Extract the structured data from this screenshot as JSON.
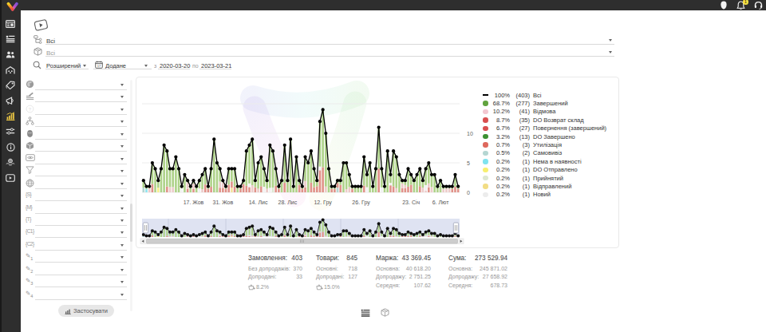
{
  "topbar": {
    "notifications_badge": "1"
  },
  "sidebar": {
    "items": [
      {
        "icon": "dashboard-icon"
      },
      {
        "icon": "orders-list-icon"
      },
      {
        "icon": "users-icon"
      },
      {
        "icon": "warehouse-icon"
      },
      {
        "icon": "pricetag-icon"
      },
      {
        "icon": "megaphone-icon"
      },
      {
        "icon": "analytics-icon",
        "active": true
      },
      {
        "icon": "sliders-icon"
      },
      {
        "icon": "info-icon"
      },
      {
        "icon": "partners-icon"
      },
      {
        "icon": "video-icon"
      }
    ]
  },
  "toolbar": {
    "status_filter": {
      "value": "Всі"
    },
    "product_filter": {
      "value": "Всі"
    },
    "search_mode": {
      "value": "Розширений"
    },
    "date_field": {
      "value": "Додане"
    },
    "date_from_label": "з",
    "date_from": "2020-03-20",
    "date_to_label": "по",
    "date_to": "2023-03-21"
  },
  "filter_panel": {
    "rows": [
      {
        "icon": "globe-solid-icon"
      },
      {
        "icon": "pen-lines-icon"
      },
      {
        "icon": "question-circle-icon"
      },
      {
        "icon": "hierarchy-icon"
      },
      {
        "icon": "person-dark-icon"
      },
      {
        "icon": "cube-icon"
      },
      {
        "icon": "banner-eye-icon"
      },
      {
        "icon": "funnel-icon"
      },
      {
        "icon": "globe-wire-icon"
      },
      {
        "icon": "braces-icon",
        "glyph": "S"
      },
      {
        "icon": "braces-icon",
        "glyph": "M"
      },
      {
        "icon": "braces-icon",
        "glyph": "T"
      },
      {
        "icon": "braces-icon",
        "glyph": "C1"
      },
      {
        "icon": "braces-icon",
        "glyph": "C2"
      },
      {
        "icon": "pencil-icon",
        "glyph": "1"
      },
      {
        "icon": "pencil-icon",
        "glyph": "2"
      },
      {
        "icon": "pencil-icon",
        "glyph": "3"
      },
      {
        "icon": "pencil-icon",
        "glyph": "4"
      }
    ],
    "apply_label": "Застосувати"
  },
  "chart_data": {
    "type": "line+stacked-bar",
    "title": "",
    "ylim": [
      0,
      15
    ],
    "y_ticks": [
      0,
      5,
      10
    ],
    "x_tick_indices": [
      17,
      27,
      39,
      49,
      61,
      74,
      91,
      101
    ],
    "x_tick_labels": [
      "17. Жов",
      "31. Жов",
      "14. Лис",
      "28. Лис",
      "12. Гру",
      "26. Гру",
      "23. Січ",
      "6. Лют"
    ],
    "totals": [
      2,
      1,
      1,
      5,
      4,
      2,
      4,
      8,
      7,
      4,
      4,
      6,
      4,
      1,
      3,
      2,
      1,
      2,
      1,
      2,
      3,
      4,
      1,
      4,
      9,
      5,
      4,
      2,
      1,
      4,
      4,
      4,
      1,
      1,
      2,
      7,
      8,
      9,
      2,
      5,
      6,
      4,
      2,
      8,
      7,
      4,
      1,
      2,
      8,
      2,
      9,
      1,
      6,
      2,
      1,
      6,
      5,
      7,
      4,
      2,
      12,
      14,
      10,
      4,
      1,
      1,
      2,
      2,
      5,
      5,
      3,
      1,
      1,
      1,
      1,
      6,
      3,
      5,
      1,
      4,
      11,
      4,
      1,
      7,
      3,
      7,
      6,
      3,
      2,
      2,
      4,
      3,
      2,
      3,
      4,
      2,
      4,
      5,
      3,
      3,
      1,
      2,
      1,
      1,
      1,
      1,
      3,
      1
    ],
    "bars": [
      [
        [
          "t",
          0.8
        ],
        [
          "g",
          1.2
        ]
      ],
      [
        [
          "c",
          0.6
        ],
        [
          "g",
          0.4
        ]
      ],
      [
        [
          "p",
          0.7
        ],
        [
          "g",
          0.3
        ]
      ],
      [
        [
          "r",
          1.41
        ],
        [
          "g",
          3.59
        ]
      ],
      [
        [
          "g",
          4.0
        ]
      ],
      [
        [
          "y",
          0.8
        ],
        [
          "g",
          1.2
        ]
      ],
      [
        [
          "g",
          4.0
        ]
      ],
      [
        [
          "g",
          8.0
        ]
      ],
      [
        [
          "r",
          0.99
        ],
        [
          "g",
          6.01
        ]
      ],
      [
        [
          "p",
          0.89
        ],
        [
          "g",
          3.11
        ]
      ],
      [
        [
          "p",
          0.89
        ],
        [
          "g",
          3.11
        ]
      ],
      [
        [
          "g",
          6.0
        ]
      ],
      [
        [
          "g",
          4.0
        ]
      ],
      [
        [
          "w",
          0.71
        ],
        [
          "g",
          0.29
        ]
      ],
      [
        [
          "g",
          3.0
        ]
      ],
      [
        [
          "r",
          0.59
        ],
        [
          "p",
          1.11
        ],
        [
          "g",
          0.3
        ]
      ],
      [
        [
          "g",
          1.0
        ]
      ],
      [
        [
          "r",
          0.61
        ],
        [
          "p",
          0.89
        ],
        [
          "g",
          0.5
        ]
      ],
      [
        [
          "g",
          1.0
        ]
      ],
      [
        [
          "w",
          0.68
        ],
        [
          "g",
          1.32
        ]
      ],
      [
        [
          "p",
          0.54
        ],
        [
          "g",
          2.46
        ]
      ],
      [
        [
          "r",
          1.33
        ],
        [
          "g",
          2.67
        ]
      ],
      [
        [
          "r",
          0.6
        ],
        [
          "g",
          0.4
        ]
      ],
      [
        [
          "r",
          0.95
        ],
        [
          "g",
          3.05
        ]
      ],
      [
        [
          "g",
          9.0
        ]
      ],
      [
        [
          "g",
          5.0
        ]
      ],
      [
        [
          "r",
          0.78
        ],
        [
          "p",
          1.04
        ],
        [
          "g",
          2.18
        ]
      ],
      [
        [
          "r",
          0.76
        ],
        [
          "p",
          0.94
        ],
        [
          "g",
          0.3
        ]
      ],
      [
        [
          "r",
          0.6
        ],
        [
          "g",
          0.4
        ]
      ],
      [
        [
          "r",
          1.31
        ],
        [
          "g",
          2.69
        ]
      ],
      [
        [
          "ly",
          0.8
        ],
        [
          "r",
          1.04
        ],
        [
          "g",
          2.16
        ]
      ],
      [
        [
          "r",
          0.97
        ],
        [
          "g",
          3.03
        ]
      ],
      [
        [
          "g",
          1.0
        ]
      ],
      [
        [
          "r",
          0.6
        ],
        [
          "g",
          0.4
        ]
      ],
      [
        [
          "r",
          1.41
        ],
        [
          "g",
          0.59
        ]
      ],
      [
        [
          "r",
          1.1
        ],
        [
          "g",
          5.9
        ]
      ],
      [
        [
          "r",
          0.89
        ],
        [
          "w",
          0.62
        ],
        [
          "g",
          6.49
        ]
      ],
      [
        [
          "p",
          1.22
        ],
        [
          "g",
          7.78
        ]
      ],
      [
        [
          "r",
          0.86
        ],
        [
          "g",
          1.14
        ]
      ],
      [
        [
          "p",
          0.62
        ],
        [
          "g",
          4.38
        ]
      ],
      [
        [
          "r",
          1.04
        ],
        [
          "g",
          4.96
        ]
      ],
      [
        [
          "w",
          0.94
        ],
        [
          "g",
          3.06
        ]
      ],
      [
        [
          "p",
          0.62
        ],
        [
          "g",
          1.38
        ]
      ],
      [
        [
          "w",
          0.77
        ],
        [
          "g",
          7.23
        ]
      ],
      [
        [
          "lg",
          0.8
        ],
        [
          "g",
          6.2
        ]
      ],
      [
        [
          "r",
          1.1
        ],
        [
          "g",
          2.9
        ]
      ],
      [
        [
          "r",
          0.6
        ],
        [
          "g",
          0.4
        ]
      ],
      [
        [
          "g",
          2.0
        ]
      ],
      [
        [
          "r",
          1.61
        ],
        [
          "g",
          6.39
        ]
      ],
      [
        [
          "g",
          2.0
        ]
      ],
      [
        [
          "g",
          9.0
        ]
      ],
      [
        [
          "g",
          1.0
        ]
      ],
      [
        [
          "g",
          6.0
        ]
      ],
      [
        [
          "r",
          1.27
        ],
        [
          "g",
          0.73
        ]
      ],
      [
        [
          "r",
          0.6
        ],
        [
          "g",
          0.4
        ]
      ],
      [
        [
          "r",
          0.84
        ],
        [
          "p",
          1.07
        ],
        [
          "g",
          4.09
        ]
      ],
      [
        [
          "g",
          5.0
        ]
      ],
      [
        [
          "r",
          1.64
        ],
        [
          "g",
          5.36
        ]
      ],
      [
        [
          "r",
          0.88
        ],
        [
          "g",
          3.12
        ]
      ],
      [
        [
          "r",
          1.04
        ],
        [
          "g",
          0.96
        ]
      ],
      [
        [
          "r",
          3.74
        ],
        [
          "w",
          0.63
        ],
        [
          "g",
          7.63
        ]
      ],
      [
        [
          "r",
          4.26
        ],
        [
          "g",
          9.74
        ]
      ],
      [
        [
          "p",
          0.99
        ],
        [
          "g",
          9.01
        ]
      ],
      [
        [
          "g",
          4.0
        ]
      ],
      [
        [
          "r",
          0.6
        ],
        [
          "g",
          0.4
        ]
      ],
      [
        [
          "r",
          0.6
        ],
        [
          "g",
          0.4
        ]
      ],
      [
        [
          "t",
          0.8
        ],
        [
          "r",
          0.8
        ],
        [
          "g",
          0.4
        ]
      ],
      [
        [
          "r",
          1.28
        ],
        [
          "g",
          0.72
        ]
      ],
      [
        [
          "g",
          5.0
        ]
      ],
      [
        [
          "p",
          0.54
        ],
        [
          "g",
          4.46
        ]
      ],
      [
        [
          "p",
          0.9
        ],
        [
          "g",
          2.1
        ]
      ],
      [
        [
          "r",
          0.6
        ],
        [
          "g",
          0.4
        ]
      ],
      [
        [
          "g",
          1.0
        ]
      ],
      [
        [
          "g",
          1.0
        ]
      ],
      [
        [
          "g",
          1.0
        ]
      ],
      [
        [
          "r",
          1.14
        ],
        [
          "g",
          4.86
        ]
      ],
      [
        [
          "w",
          0.87
        ],
        [
          "g",
          2.13
        ]
      ],
      [
        [
          "g",
          5.0
        ]
      ],
      [
        [
          "g",
          1.0
        ]
      ],
      [
        [
          "g",
          4.0
        ]
      ],
      [
        [
          "r",
          4.0
        ],
        [
          "g",
          7.0
        ]
      ],
      [
        [
          "w",
          0.84
        ],
        [
          "g",
          3.16
        ]
      ],
      [
        [
          "g",
          1.0
        ]
      ],
      [
        [
          "g",
          7.0
        ]
      ],
      [
        [
          "r",
          1.19
        ],
        [
          "w",
          0.41
        ],
        [
          "g",
          1.4
        ]
      ],
      [
        [
          "r",
          1.03
        ],
        [
          "g",
          5.97
        ]
      ],
      [
        [
          "p",
          0.71
        ],
        [
          "g",
          5.29
        ]
      ],
      [
        [
          "g",
          3.0
        ]
      ],
      [
        [
          "r",
          0.73
        ],
        [
          "p",
          0.78
        ],
        [
          "g",
          0.5
        ]
      ],
      [
        [
          "r",
          0.68
        ],
        [
          "p",
          0.56
        ],
        [
          "g",
          0.76
        ]
      ],
      [
        [
          "r",
          0.96
        ],
        [
          "g",
          3.04
        ]
      ],
      [
        [
          "r",
          1.28
        ],
        [
          "g",
          1.72
        ]
      ],
      [
        [
          "g",
          2.0
        ]
      ],
      [
        [
          "g",
          3.0
        ]
      ],
      [
        [
          "r",
          1.05
        ],
        [
          "g",
          2.95
        ]
      ],
      [
        [
          "p",
          0.79
        ],
        [
          "g",
          1.21
        ]
      ],
      [
        [
          "p",
          0.32
        ],
        [
          "w",
          0.91
        ],
        [
          "g",
          2.77
        ]
      ],
      [
        [
          "r",
          0.83
        ],
        [
          "p",
          0.69
        ],
        [
          "g",
          3.48
        ]
      ],
      [
        [
          "p",
          0.91
        ],
        [
          "g",
          2.09
        ]
      ],
      [
        [
          "g",
          3.0
        ]
      ],
      [
        [
          "g",
          1.0
        ]
      ],
      [
        [
          "g",
          2.0
        ]
      ],
      [
        [
          "p",
          0.59
        ],
        [
          "g",
          0.41
        ]
      ],
      [
        [
          "p",
          0.7
        ],
        [
          "g",
          0.3
        ]
      ],
      [
        [
          "p",
          0.7
        ],
        [
          "g",
          0.3
        ]
      ],
      [
        [
          "r",
          0.6
        ],
        [
          "g",
          0.4
        ]
      ],
      [
        [
          "r",
          0.95
        ],
        [
          "g",
          2.05
        ]
      ],
      [
        [
          "r",
          0.6
        ],
        [
          "g",
          0.4
        ]
      ]
    ],
    "bar_colors": {
      "g": "#aed289",
      "r": "#e09289",
      "p": "#eccbc9",
      "w": "#f1f1f1",
      "t": "#b5d6d2",
      "c": "#8fe4ee",
      "y": "#f6ef8a",
      "lg": "#dde7d2",
      "ly": "#f3e29a"
    },
    "line_color": "#000000",
    "legend": [
      {
        "pct": "100%",
        "count": "(403)",
        "label": "Всі",
        "marker": "line",
        "color": "#000000"
      },
      {
        "pct": "68.7%",
        "count": "(277)",
        "label": "Завершений",
        "marker": "dot",
        "color": "#61a33e"
      },
      {
        "pct": "10.2%",
        "count": "(41)",
        "label": "Відмова",
        "marker": "dot",
        "color": "#f3c7d0"
      },
      {
        "pct": "8.7%",
        "count": "(35)",
        "label": "DO Возврат склад",
        "marker": "dot",
        "color": "#d94f4f"
      },
      {
        "pct": "6.7%",
        "count": "(27)",
        "label": "Повернення (завершений)",
        "marker": "dot",
        "color": "#d94f4f"
      },
      {
        "pct": "3.2%",
        "count": "(13)",
        "label": "DO Завершено",
        "marker": "dot",
        "color": "#3c9132"
      },
      {
        "pct": "0.7%",
        "count": "(3)",
        "label": "Утилізація",
        "marker": "dot",
        "color": "#de685d"
      },
      {
        "pct": "0.5%",
        "count": "(2)",
        "label": "Самовивіз",
        "marker": "dot",
        "color": "#b5d6d2"
      },
      {
        "pct": "0.2%",
        "count": "(1)",
        "label": "Нема в наявності",
        "marker": "dot",
        "color": "#7fe3ef"
      },
      {
        "pct": "0.2%",
        "count": "(1)",
        "label": "DO Отправлено",
        "marker": "dot",
        "color": "#f7ef6f"
      },
      {
        "pct": "0.2%",
        "count": "(1)",
        "label": "Прийнятий",
        "marker": "dot",
        "color": "#dde7d2"
      },
      {
        "pct": "0.2%",
        "count": "(1)",
        "label": "Відправлений",
        "marker": "dot",
        "color": "#f2dd85"
      },
      {
        "pct": "0.2%",
        "count": "(1)",
        "label": "Новий",
        "marker": "dot",
        "color": "#ececec"
      }
    ]
  },
  "stats": {
    "columns": [
      {
        "title": "Замовлення:",
        "value": "403",
        "rows": [
          {
            "label": "Без допродажів:",
            "value": "370"
          },
          {
            "label": "Допродані:",
            "value": "33"
          }
        ],
        "footer": {
          "icon": "basket-icon",
          "value": "8.2%"
        }
      },
      {
        "title": "Товари:",
        "value": "845",
        "rows": [
          {
            "label": "Основні:",
            "value": "718"
          },
          {
            "label": "Допродані:",
            "value": "127"
          }
        ],
        "footer": {
          "icon": "basket-icon",
          "value": "15.0%"
        }
      },
      {
        "title": "Маржа:",
        "value": "43 369.45",
        "rows": [
          {
            "label": "Основна:",
            "value": "40 618.20"
          },
          {
            "label": "Допродажу:",
            "value": "2 751.25"
          },
          {
            "label": "Середня:",
            "value": "107.62"
          }
        ]
      },
      {
        "title": "Сума:",
        "value": "273 529.94",
        "rows": [
          {
            "label": "Основна:",
            "value": "245 871.02"
          },
          {
            "label": "Допродажу:",
            "value": "27 658.92"
          },
          {
            "label": "Середня:",
            "value": "678.73"
          }
        ]
      }
    ]
  },
  "footer_toggles": [
    {
      "icon": "list-view-icon",
      "active": true
    },
    {
      "icon": "package-view-icon",
      "active": false
    }
  ]
}
